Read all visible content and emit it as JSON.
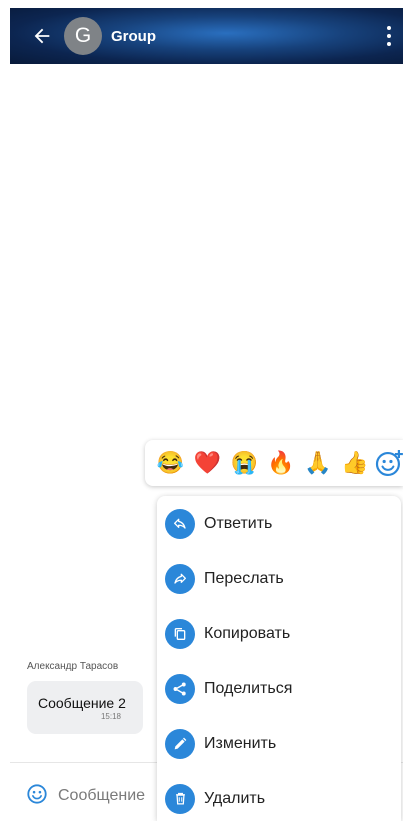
{
  "header": {
    "avatar_letter": "G",
    "title": "Group"
  },
  "messages": [
    {
      "sender": "Александр Тарасов",
      "text": "Сообщение 2",
      "time": "15:18"
    }
  ],
  "input": {
    "placeholder": "Сообщение"
  },
  "reactions": [
    "😂",
    "❤️",
    "😭",
    "🔥",
    "🙏",
    "👍"
  ],
  "context_menu": {
    "items": [
      {
        "label": "Ответить",
        "icon": "reply-icon"
      },
      {
        "label": "Переслать",
        "icon": "forward-icon"
      },
      {
        "label": "Копировать",
        "icon": "copy-icon"
      },
      {
        "label": "Поделиться",
        "icon": "share-icon"
      },
      {
        "label": "Изменить",
        "icon": "edit-icon"
      },
      {
        "label": "Удалить",
        "icon": "delete-icon"
      }
    ]
  },
  "colors": {
    "accent": "#2b87d9",
    "header_dark": "#0c2550",
    "bubble": "#eeeff1"
  }
}
